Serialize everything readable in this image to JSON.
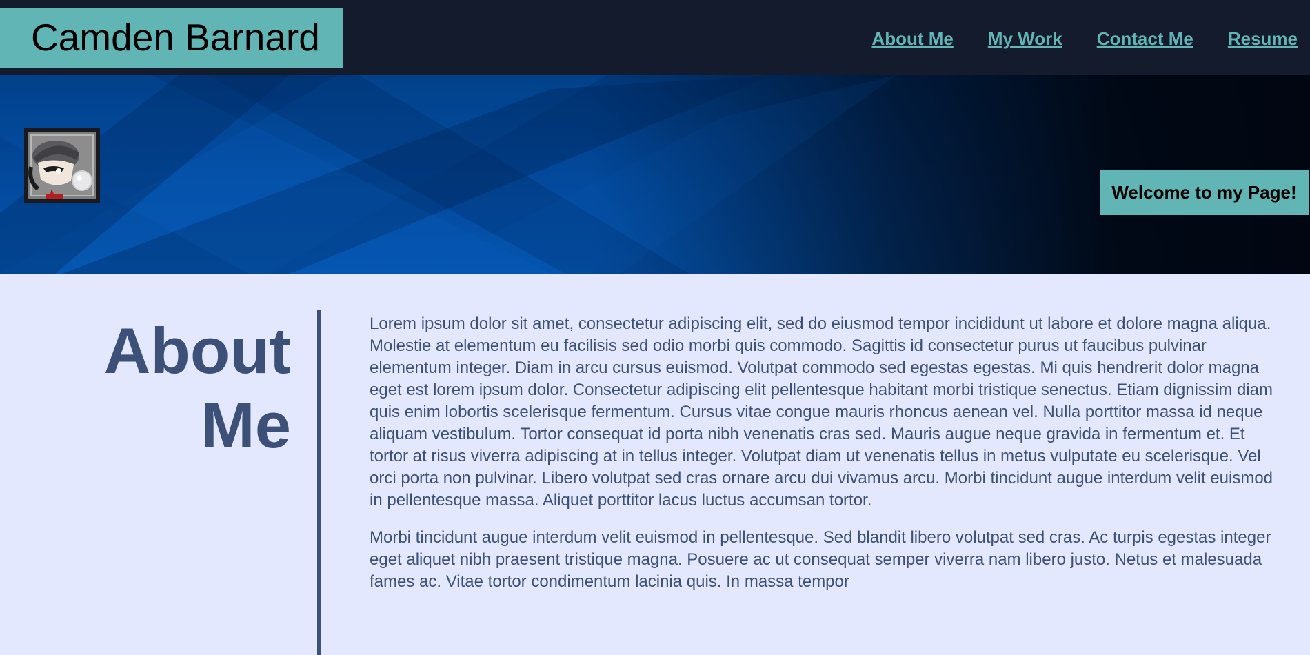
{
  "header": {
    "brand": "Camden Barnard",
    "nav": [
      {
        "label": "About Me"
      },
      {
        "label": "My Work"
      },
      {
        "label": "Contact Me"
      },
      {
        "label": "Resume"
      }
    ]
  },
  "hero": {
    "welcome": "Welcome to my Page!"
  },
  "about": {
    "title_line1": "About",
    "title_line2": "Me",
    "paragraphs": [
      "Lorem ipsum dolor sit amet, consectetur adipiscing elit, sed do eiusmod tempor incididunt ut labore et dolore magna aliqua. Molestie at elementum eu facilisis sed odio morbi quis commodo. Sagittis id consectetur purus ut faucibus pulvinar elementum integer. Diam in arcu cursus euismod. Volutpat commodo sed egestas egestas. Mi quis hendrerit dolor magna eget est lorem ipsum dolor. Consectetur adipiscing elit pellentesque habitant morbi tristique senectus. Etiam dignissim diam quis enim lobortis scelerisque fermentum. Cursus vitae congue mauris rhoncus aenean vel. Nulla porttitor massa id neque aliquam vestibulum. Tortor consequat id porta nibh venenatis cras sed. Mauris augue neque gravida in fermentum et. Et tortor at risus viverra adipiscing at in tellus integer. Volutpat diam ut venenatis tellus in metus vulputate eu scelerisque. Vel orci porta non pulvinar. Libero volutpat sed cras ornare arcu dui vivamus arcu. Morbi tincidunt augue interdum velit euismod in pellentesque massa. Aliquet porttitor lacus luctus accumsan tortor.",
      "Morbi tincidunt augue interdum velit euismod in pellentesque. Sed blandit libero volutpat sed cras. Ac turpis egestas integer eget aliquet nibh praesent tristique magna. Posuere ac ut consequat semper viverra nam libero justo. Netus et malesuada fames ac. Vitae tortor condimentum lacinia quis. In massa tempor"
    ]
  },
  "colors": {
    "header_bg": "#131b2d",
    "accent": "#61b5b5",
    "text_primary": "#3c5078",
    "page_bg": "#e4e8ff"
  },
  "icons": {
    "avatar": "cartoon-avatar-icon"
  }
}
